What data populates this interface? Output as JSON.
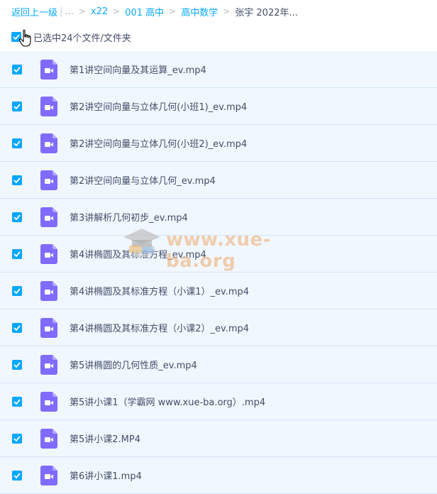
{
  "breadcrumb": {
    "back_label": "返回上一级",
    "ellipsis": "...",
    "items": [
      "x22",
      "001 高中",
      "高中数学"
    ],
    "current": "张宇 2022年..."
  },
  "selection": {
    "label": "已选中24个文件/文件夹"
  },
  "files": [
    {
      "name": "第1讲空间向量及其运算_ev.mp4"
    },
    {
      "name": "第2讲空间向量与立体几何(小班1)_ev.mp4"
    },
    {
      "name": "第2讲空间向量与立体几何(小班2)_ev.mp4"
    },
    {
      "name": "第2讲空间向量与立体几何_ev.mp4"
    },
    {
      "name": "第3讲解析几何初步_ev.mp4"
    },
    {
      "name": "第4讲椭圆及其标准方程_ev.mp4"
    },
    {
      "name": "第4讲椭圆及其标准方程（小课1）_ev.mp4"
    },
    {
      "name": "第4讲椭圆及其标准方程（小课2）_ev.mp4"
    },
    {
      "name": "第5讲椭圆的几何性质_ev.mp4"
    },
    {
      "name": "第5讲小课1（学霸网 www.xue-ba.org）.mp4"
    },
    {
      "name": "第5讲小课2.MP4"
    },
    {
      "name": "第6讲小课1.mp4"
    }
  ],
  "watermark": {
    "text": "www.xue-ba.org"
  },
  "colors": {
    "accent": "#06a7ff",
    "link": "#09aaff",
    "row_bg": "#f1f7ff",
    "video_icon": "#7f6bff"
  },
  "icons": {
    "checkbox": "checkmark-icon",
    "file": "video-file-icon",
    "cursor": "hand-pointer-icon"
  }
}
